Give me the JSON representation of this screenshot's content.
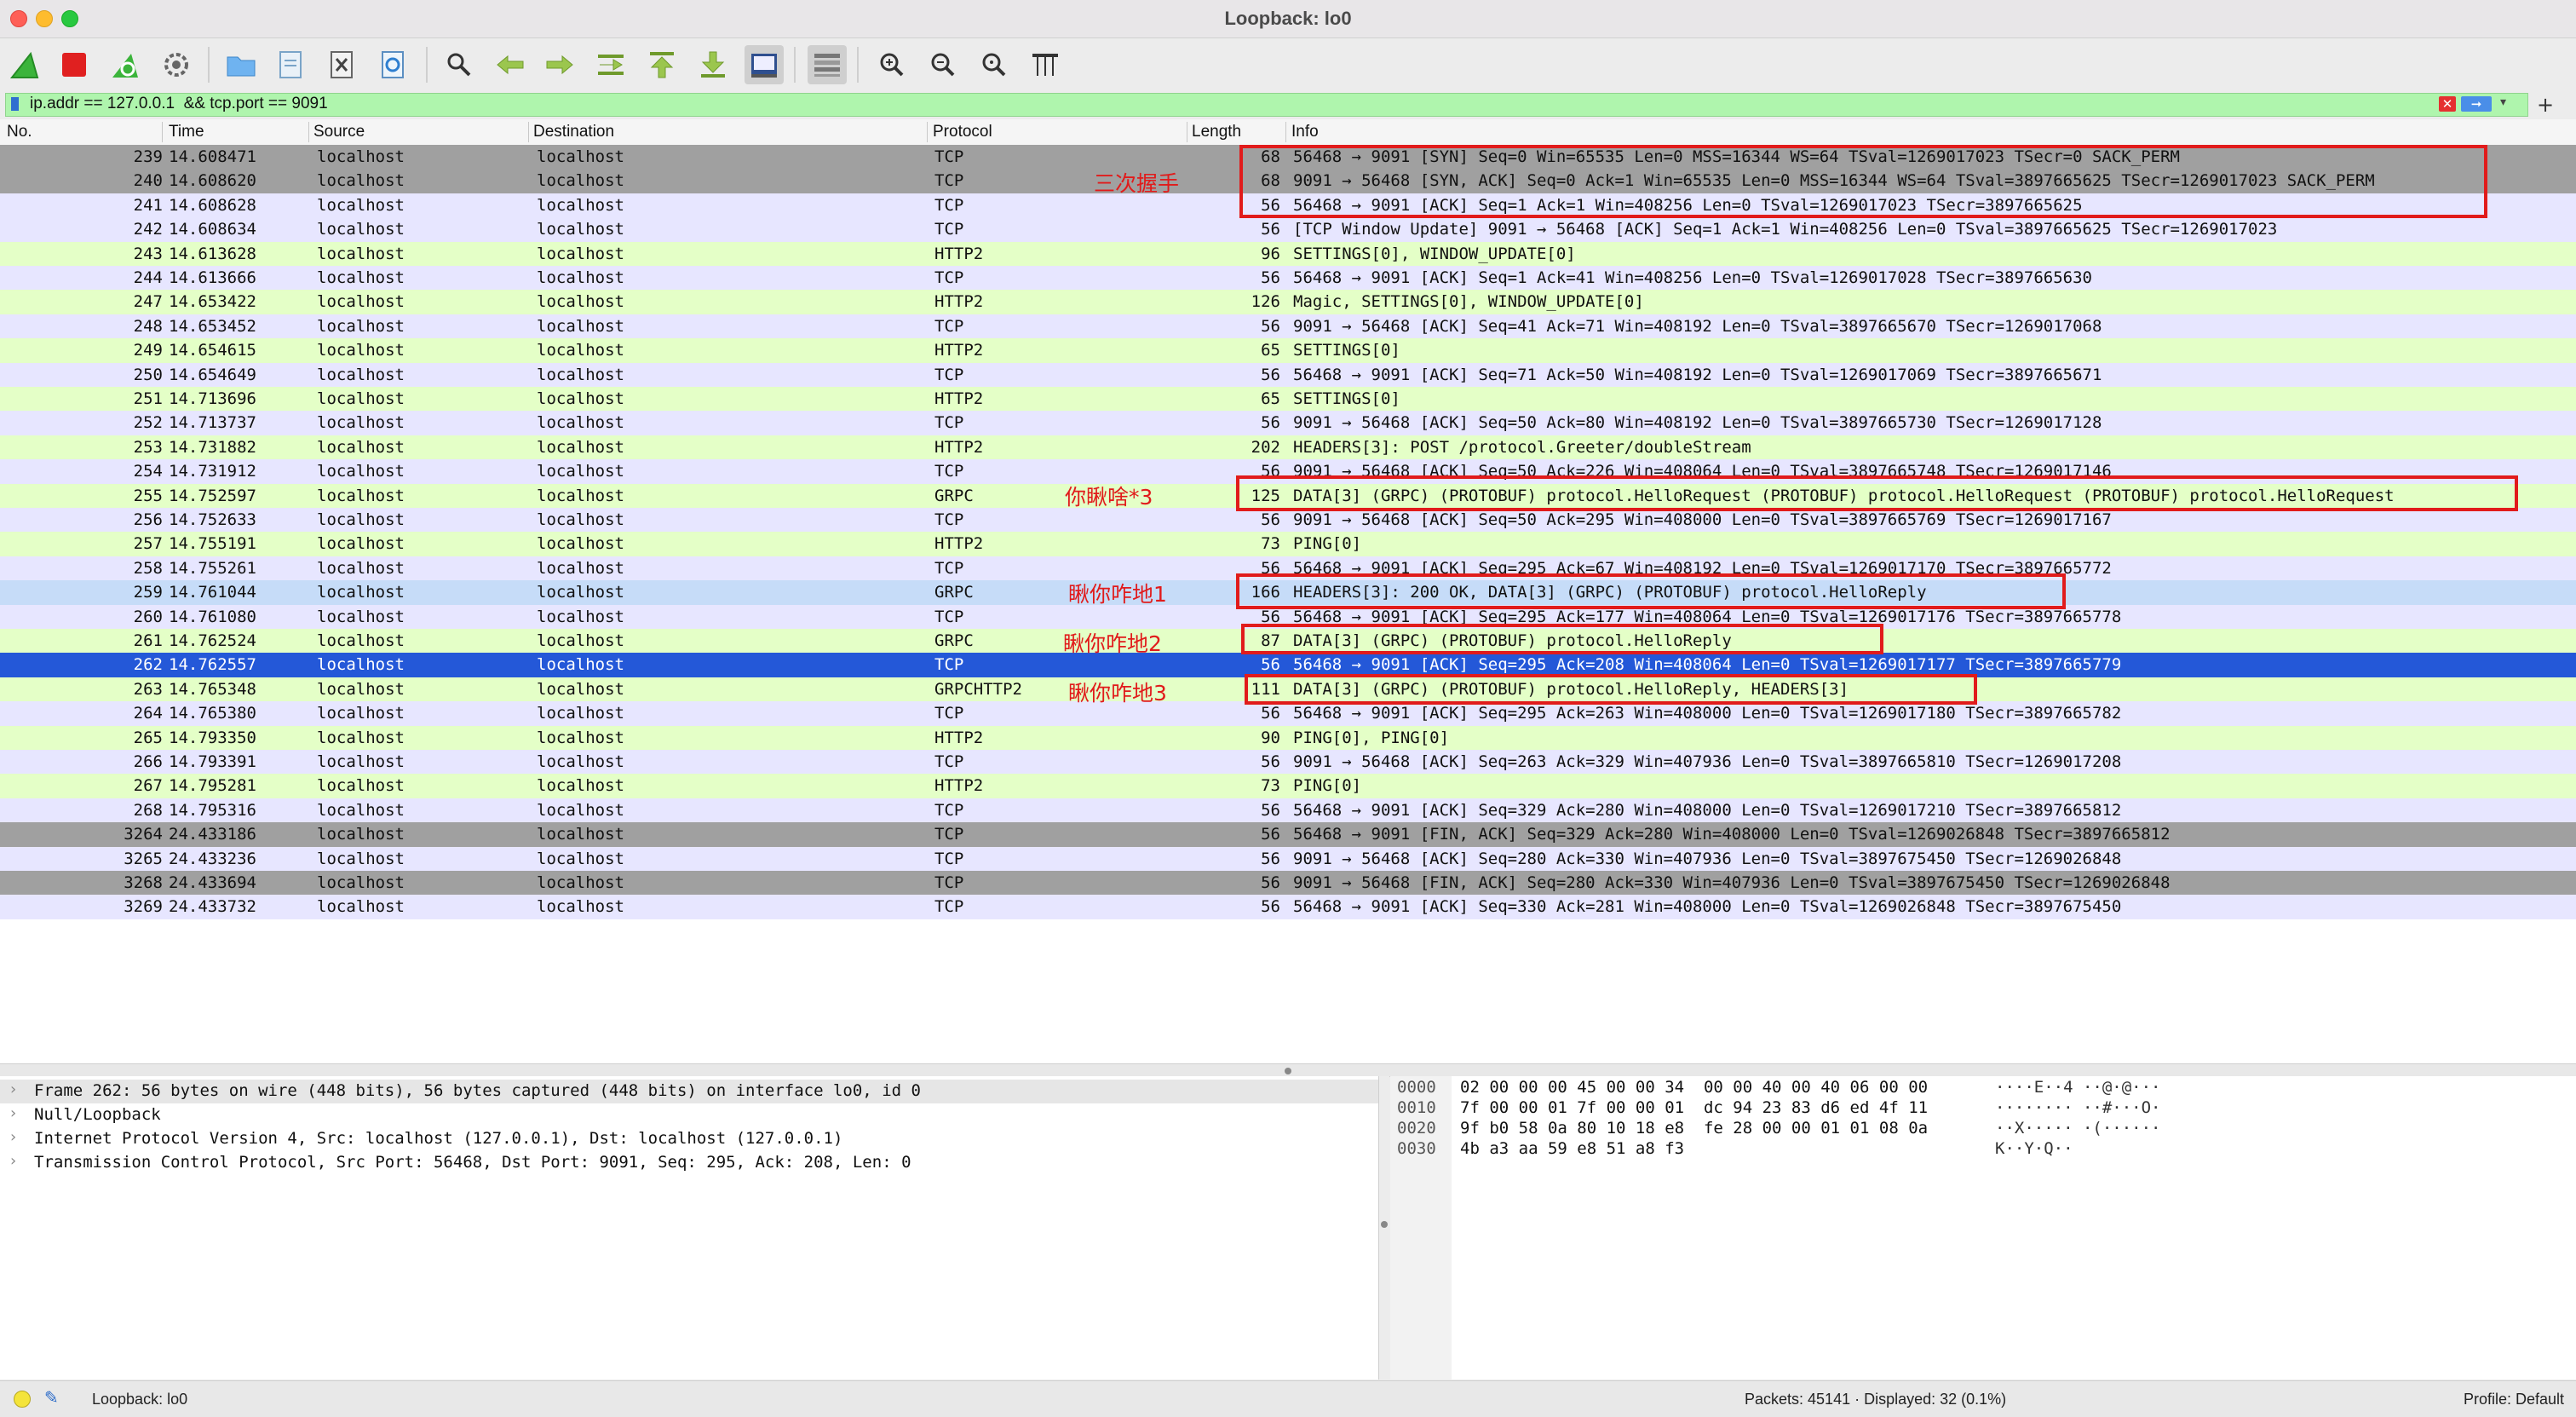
{
  "window": {
    "title": "Loopback: lo0"
  },
  "toolbar": {
    "icons": [
      "shark-fin-start-icon",
      "stop-capture-icon",
      "restart-capture-icon",
      "capture-options-icon",
      "open-file-icon",
      "file-save-icon",
      "close-file-icon",
      "reload-file-icon",
      "find-packet-icon",
      "go-back-icon",
      "go-forward-icon",
      "go-to-packet-icon",
      "go-first-icon",
      "go-last-icon",
      "autoscroll-icon",
      "colorize-icon",
      "zoom-in-icon",
      "zoom-out-icon",
      "zoom-normal-icon",
      "resize-columns-icon"
    ],
    "colors": {
      "accent": "#2f7fd0",
      "stop": "#e02020",
      "shark": "#3bb43b"
    }
  },
  "filter": {
    "value": "ip.addr == 127.0.0.1  && tcp.port == 9091",
    "bg_color": "#aff5ad"
  },
  "columns": [
    "No.",
    "Time",
    "Source",
    "Destination",
    "Protocol",
    "Length",
    "Info"
  ],
  "packets": [
    {
      "no": "239",
      "time": "14.608471",
      "src": "localhost",
      "dst": "localhost",
      "proto": "TCP",
      "len": "68",
      "info": "56468 → 9091 [SYN] Seq=0 Win=65535 Len=0 MSS=16344 WS=64 TSval=1269017023 TSecr=0 SACK_PERM",
      "style": "dark"
    },
    {
      "no": "240",
      "time": "14.608620",
      "src": "localhost",
      "dst": "localhost",
      "proto": "TCP",
      "len": "68",
      "info": "9091 → 56468 [SYN, ACK] Seq=0 Ack=1 Win=65535 Len=0 MSS=16344 WS=64 TSval=3897665625 TSecr=1269017023 SACK_PERM",
      "style": "dark"
    },
    {
      "no": "241",
      "time": "14.608628",
      "src": "localhost",
      "dst": "localhost",
      "proto": "TCP",
      "len": "56",
      "info": "56468 → 9091 [ACK] Seq=1 Ack=1 Win=408256 Len=0 TSval=1269017023 TSecr=3897665625",
      "style": "tcp"
    },
    {
      "no": "242",
      "time": "14.608634",
      "src": "localhost",
      "dst": "localhost",
      "proto": "TCP",
      "len": "56",
      "info": "[TCP Window Update] 9091 → 56468 [ACK] Seq=1 Ack=1 Win=408256 Len=0 TSval=3897665625 TSecr=1269017023",
      "style": "tcp"
    },
    {
      "no": "243",
      "time": "14.613628",
      "src": "localhost",
      "dst": "localhost",
      "proto": "HTTP2",
      "len": "96",
      "info": "SETTINGS[0], WINDOW_UPDATE[0]",
      "style": "http2"
    },
    {
      "no": "244",
      "time": "14.613666",
      "src": "localhost",
      "dst": "localhost",
      "proto": "TCP",
      "len": "56",
      "info": "56468 → 9091 [ACK] Seq=1 Ack=41 Win=408256 Len=0 TSval=1269017028 TSecr=3897665630",
      "style": "tcp"
    },
    {
      "no": "247",
      "time": "14.653422",
      "src": "localhost",
      "dst": "localhost",
      "proto": "HTTP2",
      "len": "126",
      "info": "Magic, SETTINGS[0], WINDOW_UPDATE[0]",
      "style": "http2"
    },
    {
      "no": "248",
      "time": "14.653452",
      "src": "localhost",
      "dst": "localhost",
      "proto": "TCP",
      "len": "56",
      "info": "9091 → 56468 [ACK] Seq=41 Ack=71 Win=408192 Len=0 TSval=3897665670 TSecr=1269017068",
      "style": "tcp"
    },
    {
      "no": "249",
      "time": "14.654615",
      "src": "localhost",
      "dst": "localhost",
      "proto": "HTTP2",
      "len": "65",
      "info": "SETTINGS[0]",
      "style": "http2"
    },
    {
      "no": "250",
      "time": "14.654649",
      "src": "localhost",
      "dst": "localhost",
      "proto": "TCP",
      "len": "56",
      "info": "56468 → 9091 [ACK] Seq=71 Ack=50 Win=408192 Len=0 TSval=1269017069 TSecr=3897665671",
      "style": "tcp"
    },
    {
      "no": "251",
      "time": "14.713696",
      "src": "localhost",
      "dst": "localhost",
      "proto": "HTTP2",
      "len": "65",
      "info": "SETTINGS[0]",
      "style": "http2"
    },
    {
      "no": "252",
      "time": "14.713737",
      "src": "localhost",
      "dst": "localhost",
      "proto": "TCP",
      "len": "56",
      "info": "9091 → 56468 [ACK] Seq=50 Ack=80 Win=408192 Len=0 TSval=3897665730 TSecr=1269017128",
      "style": "tcp"
    },
    {
      "no": "253",
      "time": "14.731882",
      "src": "localhost",
      "dst": "localhost",
      "proto": "HTTP2",
      "len": "202",
      "info": "HEADERS[3]: POST /protocol.Greeter/doubleStream",
      "style": "http2"
    },
    {
      "no": "254",
      "time": "14.731912",
      "src": "localhost",
      "dst": "localhost",
      "proto": "TCP",
      "len": "56",
      "info": "9091 → 56468 [ACK] Seq=50 Ack=226 Win=408064 Len=0 TSval=3897665748 TSecr=1269017146",
      "style": "tcp"
    },
    {
      "no": "255",
      "time": "14.752597",
      "src": "localhost",
      "dst": "localhost",
      "proto": "GRPC",
      "len": "125",
      "info": "DATA[3] (GRPC) (PROTOBUF) protocol.HelloRequest (PROTOBUF) protocol.HelloRequest (PROTOBUF) protocol.HelloRequest",
      "style": "http2"
    },
    {
      "no": "256",
      "time": "14.752633",
      "src": "localhost",
      "dst": "localhost",
      "proto": "TCP",
      "len": "56",
      "info": "9091 → 56468 [ACK] Seq=50 Ack=295 Win=408000 Len=0 TSval=3897665769 TSecr=1269017167",
      "style": "tcp"
    },
    {
      "no": "257",
      "time": "14.755191",
      "src": "localhost",
      "dst": "localhost",
      "proto": "HTTP2",
      "len": "73",
      "info": "PING[0]",
      "style": "http2"
    },
    {
      "no": "258",
      "time": "14.755261",
      "src": "localhost",
      "dst": "localhost",
      "proto": "TCP",
      "len": "56",
      "info": "56468 → 9091 [ACK] Seq=295 Ack=67 Win=408192 Len=0 TSval=1269017170 TSecr=3897665772",
      "style": "tcp"
    },
    {
      "no": "259",
      "time": "14.761044",
      "src": "localhost",
      "dst": "localhost",
      "proto": "GRPC",
      "len": "166",
      "info": "HEADERS[3]: 200 OK, DATA[3] (GRPC) (PROTOBUF) protocol.HelloReply",
      "style": "grpc-hi"
    },
    {
      "no": "260",
      "time": "14.761080",
      "src": "localhost",
      "dst": "localhost",
      "proto": "TCP",
      "len": "56",
      "info": "56468 → 9091 [ACK] Seq=295 Ack=177 Win=408064 Len=0 TSval=1269017176 TSecr=3897665778",
      "style": "tcp"
    },
    {
      "no": "261",
      "time": "14.762524",
      "src": "localhost",
      "dst": "localhost",
      "proto": "GRPC",
      "len": "87",
      "info": "DATA[3] (GRPC) (PROTOBUF) protocol.HelloReply",
      "style": "http2"
    },
    {
      "no": "262",
      "time": "14.762557",
      "src": "localhost",
      "dst": "localhost",
      "proto": "TCP",
      "len": "56",
      "info": "56468 → 9091 [ACK] Seq=295 Ack=208 Win=408064 Len=0 TSval=1269017177 TSecr=3897665779",
      "style": "sel"
    },
    {
      "no": "263",
      "time": "14.765348",
      "src": "localhost",
      "dst": "localhost",
      "proto": "GRPCHTTP2",
      "len": "111",
      "info": "DATA[3] (GRPC) (PROTOBUF) protocol.HelloReply, HEADERS[3]",
      "style": "http2"
    },
    {
      "no": "264",
      "time": "14.765380",
      "src": "localhost",
      "dst": "localhost",
      "proto": "TCP",
      "len": "56",
      "info": "56468 → 9091 [ACK] Seq=295 Ack=263 Win=408000 Len=0 TSval=1269017180 TSecr=3897665782",
      "style": "tcp"
    },
    {
      "no": "265",
      "time": "14.793350",
      "src": "localhost",
      "dst": "localhost",
      "proto": "HTTP2",
      "len": "90",
      "info": "PING[0], PING[0]",
      "style": "http2"
    },
    {
      "no": "266",
      "time": "14.793391",
      "src": "localhost",
      "dst": "localhost",
      "proto": "TCP",
      "len": "56",
      "info": "9091 → 56468 [ACK] Seq=263 Ack=329 Win=407936 Len=0 TSval=3897665810 TSecr=1269017208",
      "style": "tcp"
    },
    {
      "no": "267",
      "time": "14.795281",
      "src": "localhost",
      "dst": "localhost",
      "proto": "HTTP2",
      "len": "73",
      "info": "PING[0]",
      "style": "http2"
    },
    {
      "no": "268",
      "time": "14.795316",
      "src": "localhost",
      "dst": "localhost",
      "proto": "TCP",
      "len": "56",
      "info": "56468 → 9091 [ACK] Seq=329 Ack=280 Win=408000 Len=0 TSval=1269017210 TSecr=3897665812",
      "style": "tcp"
    },
    {
      "no": "3264",
      "time": "24.433186",
      "src": "localhost",
      "dst": "localhost",
      "proto": "TCP",
      "len": "56",
      "info": "56468 → 9091 [FIN, ACK] Seq=329 Ack=280 Win=408000 Len=0 TSval=1269026848 TSecr=3897665812",
      "style": "dark"
    },
    {
      "no": "3265",
      "time": "24.433236",
      "src": "localhost",
      "dst": "localhost",
      "proto": "TCP",
      "len": "56",
      "info": "9091 → 56468 [ACK] Seq=280 Ack=330 Win=407936 Len=0 TSval=3897675450 TSecr=1269026848",
      "style": "tcp"
    },
    {
      "no": "3268",
      "time": "24.433694",
      "src": "localhost",
      "dst": "localhost",
      "proto": "TCP",
      "len": "56",
      "info": "9091 → 56468 [FIN, ACK] Seq=280 Ack=330 Win=407936 Len=0 TSval=3897675450 TSecr=1269026848",
      "style": "dark"
    },
    {
      "no": "3269",
      "time": "24.433732",
      "src": "localhost",
      "dst": "localhost",
      "proto": "TCP",
      "len": "56",
      "info": "56468 → 9091 [ACK] Seq=330 Ack=281 Win=408000 Len=0 TSval=1269026848 TSecr=3897675450",
      "style": "tcp"
    }
  ],
  "row_colors": {
    "tcp": "#e7e6ff",
    "http2": "#e4ffc7",
    "dark": "#a0a0a0",
    "sel": "#2458d8",
    "grpc-hi": "#c6dcf8"
  },
  "annotations": {
    "color": "#e11b1b",
    "handshake": "三次握手",
    "request": "你瞅啥*3",
    "reply1": "瞅你咋地1",
    "reply2": "瞅你咋地2",
    "reply3": "瞅你咋地3"
  },
  "details": [
    "Frame 262: 56 bytes on wire (448 bits), 56 bytes captured (448 bits) on interface lo0, id 0",
    "Null/Loopback",
    "Internet Protocol Version 4, Src: localhost (127.0.0.1), Dst: localhost (127.0.0.1)",
    "Transmission Control Protocol, Src Port: 56468, Dst Port: 9091, Seq: 295, Ack: 208, Len: 0"
  ],
  "bytes": [
    {
      "offset": "0000",
      "hex": "02 00 00 00 45 00 00 34  00 00 40 00 40 06 00 00",
      "ascii": "····E··4 ··@·@···"
    },
    {
      "offset": "0010",
      "hex": "7f 00 00 01 7f 00 00 01  dc 94 23 83 d6 ed 4f 11",
      "ascii": "········ ··#···O·"
    },
    {
      "offset": "0020",
      "hex": "9f b0 58 0a 80 10 18 e8  fe 28 00 00 01 01 08 0a",
      "ascii": "··X····· ·(······"
    },
    {
      "offset": "0030",
      "hex": "4b a3 aa 59 e8 51 a8 f3",
      "ascii": "K··Y·Q··"
    }
  ],
  "status": {
    "interface": "Loopback: lo0",
    "packets": "Packets: 45141 · Displayed: 32 (0.1%)",
    "profile": "Profile: Default"
  }
}
